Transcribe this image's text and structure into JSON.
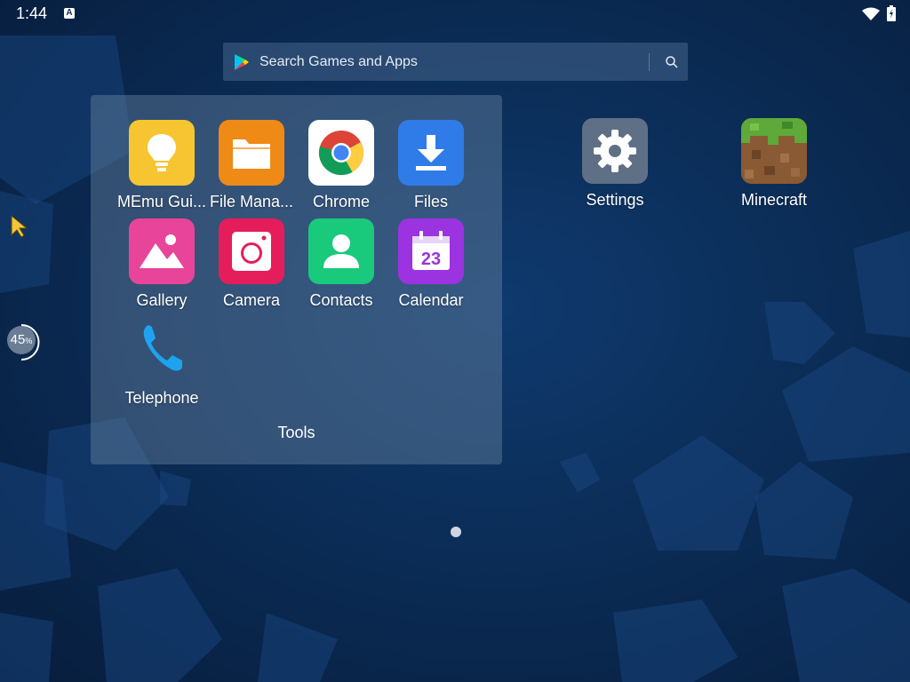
{
  "status_bar": {
    "time": "1:44",
    "notification_letter": "A",
    "icons": [
      "wifi-icon",
      "battery-icon"
    ]
  },
  "search": {
    "placeholder": "Search Games and Apps",
    "icon": "search-icon",
    "brand_icon": "google-play-icon"
  },
  "folder": {
    "name": "Tools",
    "apps": [
      {
        "label": "MEmu Gui...",
        "icon": "lightbulb-icon",
        "color": "#f7c531"
      },
      {
        "label": "File Mana...",
        "icon": "folder-icon",
        "color": "#ef8a17"
      },
      {
        "label": "Chrome",
        "icon": "chrome-icon",
        "color": "#ffffff"
      },
      {
        "label": "Files",
        "icon": "download-icon",
        "color": "#2f7be8"
      },
      {
        "label": "Gallery",
        "icon": "gallery-icon",
        "color": "#e8449a"
      },
      {
        "label": "Camera",
        "icon": "camera-icon",
        "color": "#e61d5b"
      },
      {
        "label": "Contacts",
        "icon": "contacts-icon",
        "color": "#19c97c"
      },
      {
        "label": "Calendar",
        "icon": "calendar-icon",
        "color": "#9b34e0"
      },
      {
        "label": "Telephone",
        "icon": "phone-icon",
        "color": "#1ea3f0"
      }
    ]
  },
  "desktop_apps": [
    {
      "label": "Settings",
      "icon": "gear-icon",
      "color": "#5f6f85"
    },
    {
      "label": "Minecraft",
      "icon": "minecraft-icon",
      "color": "#7a5230"
    }
  ],
  "side_progress": {
    "value": 45,
    "unit": "%"
  },
  "calendar_day": "23",
  "page_indicator": {
    "pages": 1,
    "current": 1
  }
}
